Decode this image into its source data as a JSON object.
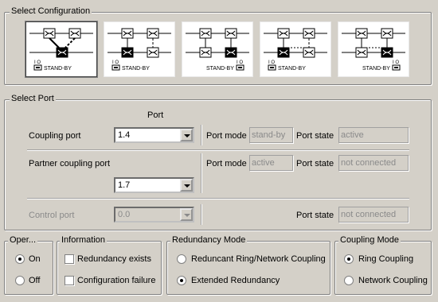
{
  "select_configuration": {
    "legend": "Select Configuration",
    "configs": [
      {
        "standby_label": "STAND-BY",
        "io": "I O",
        "selected": true
      },
      {
        "standby_label": "STAND-BY",
        "io": "I O",
        "selected": false
      },
      {
        "standby_label": "STAND-BY",
        "io": "I O",
        "selected": false
      },
      {
        "standby_label": "STAND-BY",
        "io": "I O",
        "selected": false
      },
      {
        "standby_label": "STAND-BY",
        "io": "I O",
        "selected": false
      }
    ]
  },
  "select_port": {
    "legend": "Select Port",
    "port_header": "Port",
    "coupling_port": {
      "label": "Coupling port",
      "value": "1.4",
      "port_mode_label": "Port mode",
      "port_mode": "stand-by",
      "port_state_label": "Port state",
      "port_state": "active"
    },
    "partner_coupling_port": {
      "label": "Partner coupling port",
      "value": "1.7",
      "port_mode_label": "Port mode",
      "port_mode": "active",
      "port_state_label": "Port state",
      "port_state": "not connected"
    },
    "control_port": {
      "label": "Control port",
      "value": "0.0",
      "port_state_label": "Port state",
      "port_state": "not connected"
    }
  },
  "operation": {
    "legend": "Oper...",
    "on_label": "On",
    "off_label": "Off",
    "selected": "on"
  },
  "information": {
    "legend": "Information",
    "redundancy_exists": "Redundancy exists",
    "configuration_failure": "Configuration failure"
  },
  "redundancy_mode": {
    "legend": "Redundancy Mode",
    "option_ring": "Reduncant Ring/Network Coupling",
    "option_extended": "Extended Redundancy",
    "selected": "extended"
  },
  "coupling_mode": {
    "legend": "Coupling Mode",
    "option_ring": "Ring Coupling",
    "option_network": "Network Coupling",
    "selected": "ring"
  },
  "colors": {
    "background": "#d4d0c8",
    "disabled_text": "#8a8a8a"
  }
}
